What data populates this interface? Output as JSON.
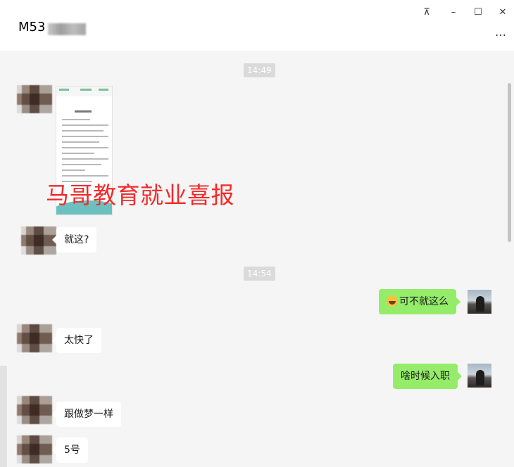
{
  "window": {
    "contact_name": "M53",
    "controls": {
      "pin": "⊼",
      "minimize": "–",
      "maximize": "☐",
      "close": "✕",
      "more": "…"
    }
  },
  "messages": [
    {
      "kind": "timestamp",
      "text": "14:49"
    },
    {
      "kind": "image",
      "from": "peer",
      "overlay_text": "马哥教育就业喜报"
    },
    {
      "kind": "text",
      "from": "peer",
      "text": "就这?"
    },
    {
      "kind": "timestamp",
      "text": "14:54"
    },
    {
      "kind": "text",
      "from": "self",
      "emoji": "grinning-tears-emoji",
      "text": "可不就这么"
    },
    {
      "kind": "text",
      "from": "peer",
      "text": "太快了"
    },
    {
      "kind": "text",
      "from": "self",
      "text": "啥时候入职"
    },
    {
      "kind": "text",
      "from": "peer",
      "text": "跟做梦一样"
    },
    {
      "kind": "text",
      "from": "peer",
      "text": "5号"
    }
  ],
  "colors": {
    "chat_background": "#f5f5f5",
    "incoming_bubble": "#ffffff",
    "outgoing_bubble": "#95ec69",
    "timestamp_pill": "#dadada",
    "overlay_red": "#f12b2b"
  }
}
